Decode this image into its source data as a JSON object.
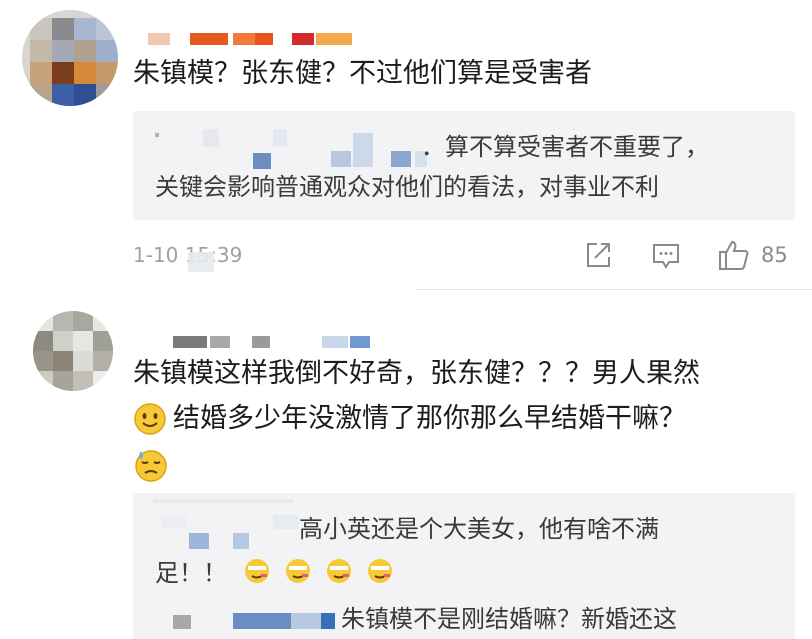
{
  "comments": [
    {
      "text": "朱镇模？张东健？不过他们算是受害者",
      "reply_tail": "．算不算受害者不重要了，",
      "reply_line2": "关键会影响普通观众对他们的看法，对事业不利",
      "timestamp": "1-10 15:39",
      "like_count": "85"
    },
    {
      "text_line1": "朱镇模这样我倒不好奇，张东健？？？男人果然",
      "text_line2": "结婚多少年没激情了那你那么早结婚干嘛？",
      "reply1_line1": "高小英还是个大美女，他有啥不满",
      "reply1_line2": "足！！",
      "reply2_line1": "朱镇模不是刚结婚嘛？新婚还这"
    }
  ],
  "icons": [
    "share-icon",
    "comment-icon",
    "like-icon",
    "smile-emoji-icon",
    "sweat-emoji-icon",
    "sick-emoji-icon"
  ],
  "colors": {
    "quote_bg": "#f3f3f5",
    "meta_gray": "#a0a0a0",
    "emoji_yellow": "#f7c936"
  }
}
